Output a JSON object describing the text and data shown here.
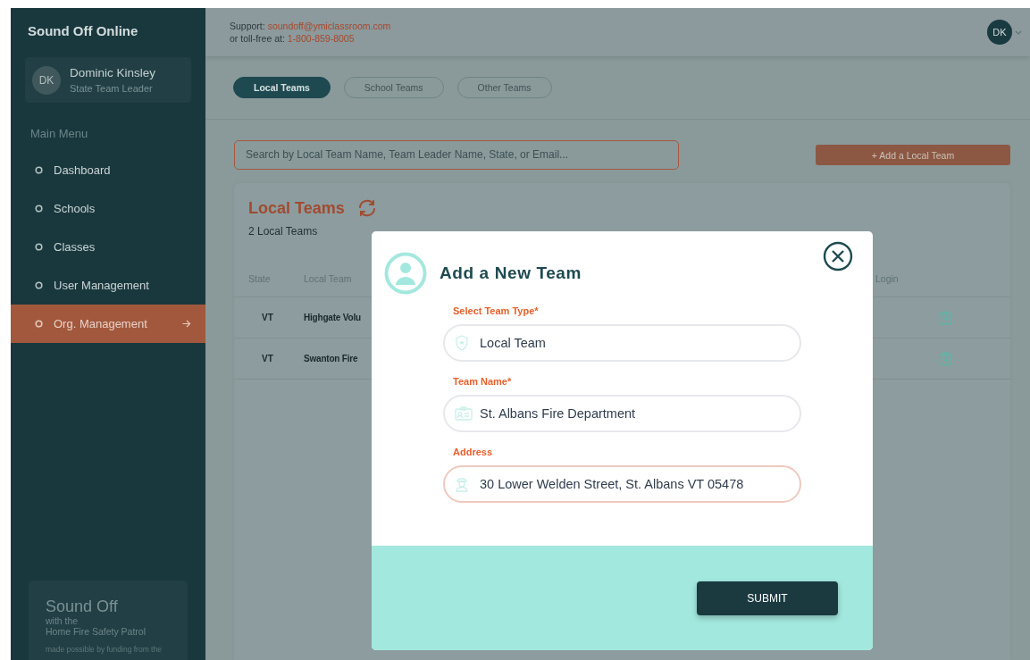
{
  "sidebar": {
    "title": "Sound Off Online",
    "user": {
      "initials": "DK",
      "name": "Dominic Kinsley",
      "role": "State Team Leader"
    },
    "menu_heading": "Main Menu",
    "items": [
      {
        "label": "Dashboard",
        "selected": false
      },
      {
        "label": "Schools",
        "selected": false
      },
      {
        "label": "Classes",
        "selected": false
      },
      {
        "label": "User Management",
        "selected": false
      },
      {
        "label": "Org. Management",
        "selected": true
      }
    ],
    "promo": {
      "title": "Sound Off",
      "subtitle": "with the",
      "tagline": "Home Fire Safety Patrol",
      "note": "made possible by funding from the"
    }
  },
  "header": {
    "support_label": "Support:",
    "support_email": "soundoff@ymiclassroom.com",
    "phone_label": "or toll-free at:",
    "phone": "1-800-859-8005",
    "avatar_initials": "DK"
  },
  "tabs": [
    {
      "label": "Local Teams",
      "selected": true
    },
    {
      "label": "School Teams",
      "selected": false
    },
    {
      "label": "Other Teams",
      "selected": false
    }
  ],
  "search": {
    "placeholder": "Search by Local Team Name, Team Leader Name, State, or Email..."
  },
  "add_button": "+ Add a Local Team",
  "card": {
    "title": "Local Teams",
    "count": "2 Local Teams",
    "columns": [
      "State",
      "Local Team",
      "Login"
    ],
    "rows": [
      {
        "state": "VT",
        "name": "Highgate Volu"
      },
      {
        "state": "VT",
        "name": "Swanton Fire"
      }
    ]
  },
  "modal": {
    "title": "Add a New Team",
    "fields": [
      {
        "label": "Select Team Type*",
        "value": "Local Team",
        "focused": false
      },
      {
        "label": "Team Name*",
        "value": "St. Albans Fire Department",
        "focused": false
      },
      {
        "label": "Address",
        "value": "30 Lower Welden Street, St. Albans VT 05478",
        "focused": true
      }
    ],
    "submit": "SUBMIT"
  }
}
